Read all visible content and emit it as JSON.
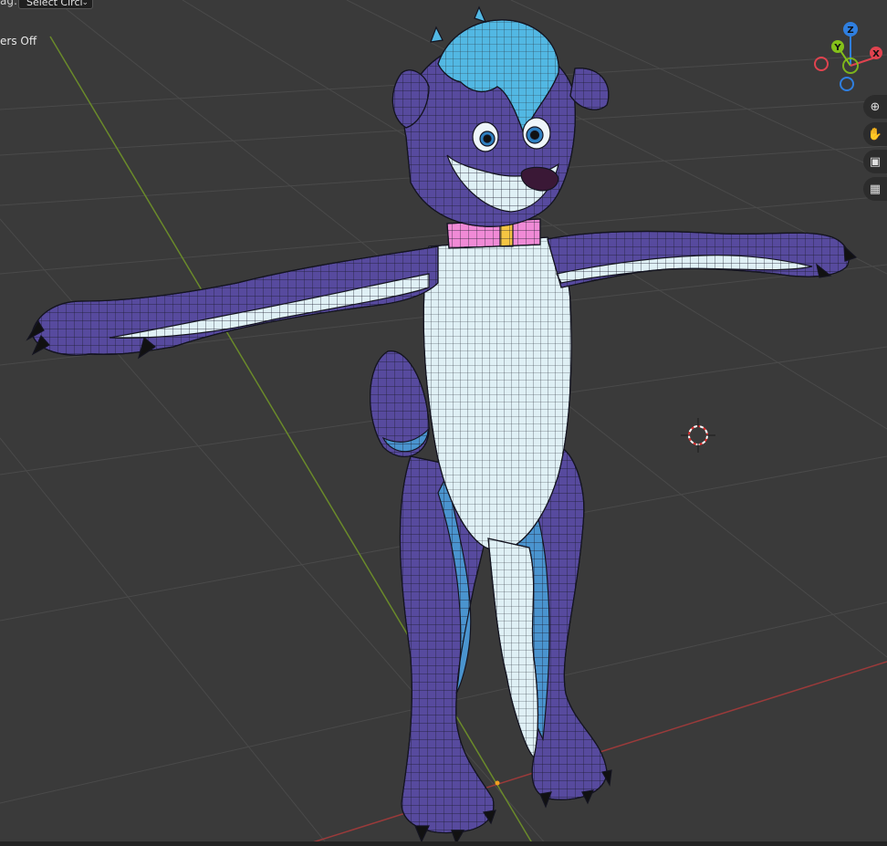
{
  "header": {
    "drag_label": "ag:",
    "select_mode": "Select Circl"
  },
  "viewport": {
    "overlay_text": "ers Off"
  },
  "gizmo": {
    "axes": {
      "z": "Z",
      "y": "Y",
      "x": "X"
    },
    "colors": {
      "x": "#e0434f",
      "y": "#84c11a",
      "z": "#2f7fe0"
    }
  },
  "navigation": {
    "icons": [
      "zoom-icon",
      "hand-pan-icon",
      "camera-icon",
      "grid-view-icon"
    ]
  },
  "colors": {
    "background": "#3a3a3a",
    "fur_purple": "#574a9e",
    "fur_light": "#dff0f5",
    "fur_blue": "#4a94cf",
    "hair": "#52b8e3",
    "collar_pink": "#f08ad6",
    "collar_tag": "#f5c542",
    "x_axis_line": "#9b3a3a",
    "y_axis_line": "#6a8a2a"
  }
}
